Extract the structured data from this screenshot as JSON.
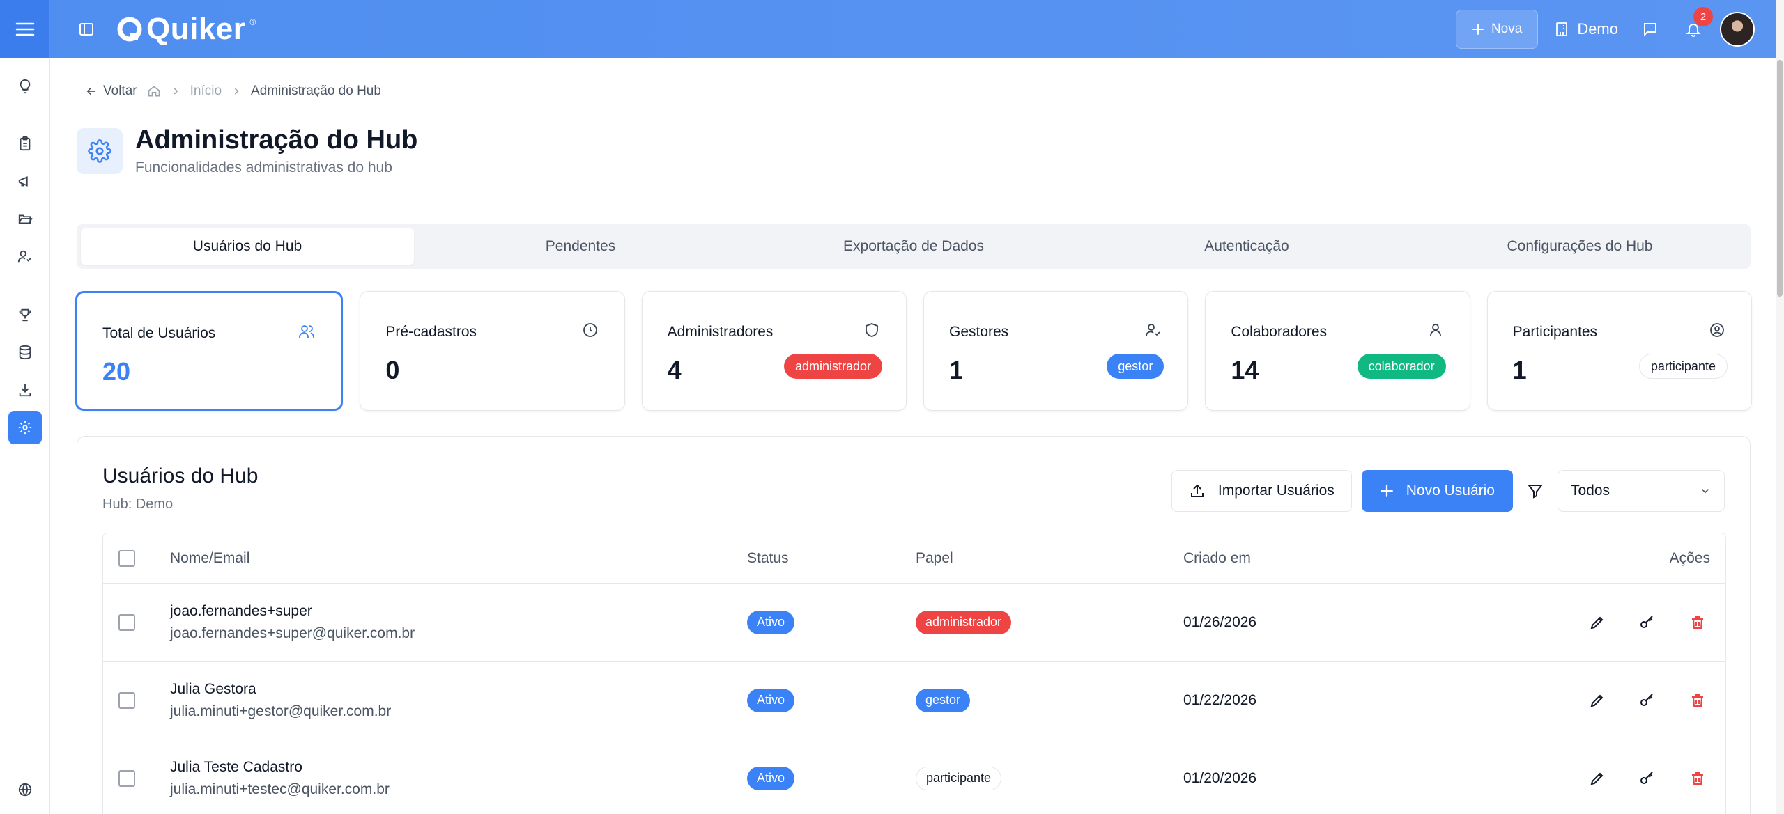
{
  "header": {
    "brand": "Quiker",
    "brand_mark": "®",
    "new_label": "Nova",
    "hub_name": "Demo",
    "notifications_count": "2"
  },
  "breadcrumb": {
    "back_label": "Voltar",
    "home_label": "Início",
    "current": "Administração do Hub"
  },
  "page": {
    "title": "Administração do Hub",
    "subtitle": "Funcionalidades administrativas do hub"
  },
  "tabs": [
    {
      "label": "Usuários do Hub",
      "active": true
    },
    {
      "label": "Pendentes",
      "active": false
    },
    {
      "label": "Exportação de Dados",
      "active": false
    },
    {
      "label": "Autenticação",
      "active": false
    },
    {
      "label": "Configurações do Hub",
      "active": false
    }
  ],
  "stats": [
    {
      "label": "Total de Usuários",
      "value": "20",
      "icon": "users-icon",
      "badge": ""
    },
    {
      "label": "Pré-cadastros",
      "value": "0",
      "icon": "clock-icon",
      "badge": ""
    },
    {
      "label": "Administradores",
      "value": "4",
      "icon": "shield-icon",
      "badge": "administrador"
    },
    {
      "label": "Gestores",
      "value": "1",
      "icon": "user-check-icon",
      "badge": "gestor"
    },
    {
      "label": "Colaboradores",
      "value": "14",
      "icon": "user-icon",
      "badge": "colaborador"
    },
    {
      "label": "Participantes",
      "value": "1",
      "icon": "user-circle-icon",
      "badge": "participante"
    }
  ],
  "users_panel": {
    "title": "Usuários do Hub",
    "subtitle": "Hub: Demo",
    "import_label": "Importar Usuários",
    "new_label": "Novo Usuário",
    "filter_value": "Todos"
  },
  "table": {
    "columns": [
      "Nome/Email",
      "Status",
      "Papel",
      "Criado em",
      "Ações"
    ],
    "rows": [
      {
        "name": "joao.fernandes+super",
        "email": "joao.fernandes+super@quiker.com.br",
        "status": "Ativo",
        "role": "administrador",
        "created": "01/26/2026"
      },
      {
        "name": "Julia Gestora",
        "email": "julia.minuti+gestor@quiker.com.br",
        "status": "Ativo",
        "role": "gestor",
        "created": "01/22/2026"
      },
      {
        "name": "Julia Teste Cadastro",
        "email": "julia.minuti+testec@quiker.com.br",
        "status": "Ativo",
        "role": "participante",
        "created": "01/20/2026"
      }
    ]
  },
  "colors": {
    "primary": "#3b82f6",
    "header": "#5b95f2",
    "danger": "#ef4444",
    "success": "#10b981"
  }
}
